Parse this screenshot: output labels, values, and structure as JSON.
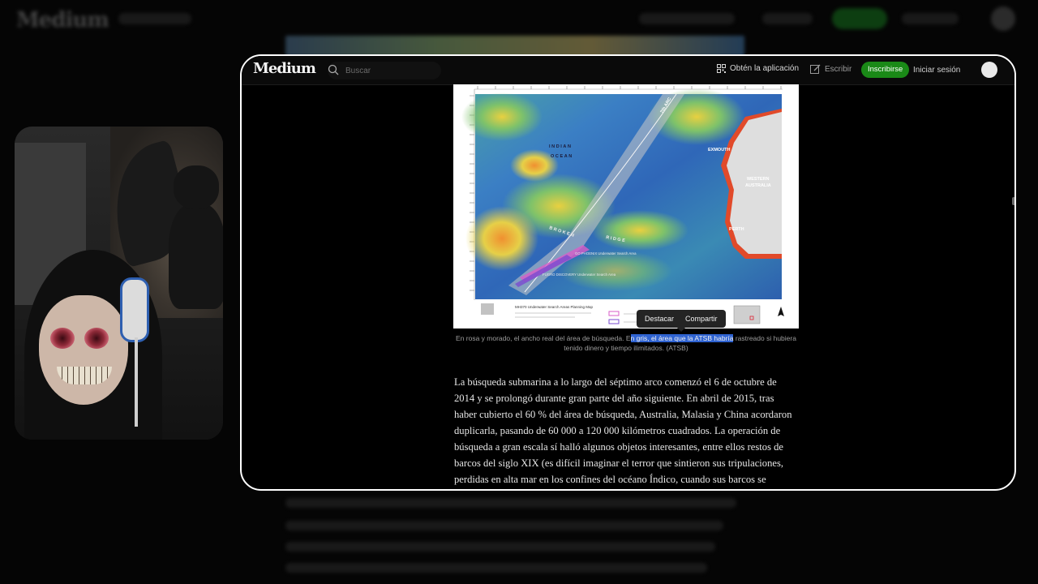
{
  "background_page": {
    "logo": "Medium"
  },
  "header": {
    "logo": "Medium",
    "search_placeholder": "Buscar",
    "get_app": "Obtén la aplicación",
    "write": "Escribir",
    "signup": "Inscribirse",
    "login": "Iniciar sesión"
  },
  "figure": {
    "caption_before": "En rosa y morado, el ancho real del área de búsqueda. E",
    "caption_highlight": "n gris, el área que la ATSB habría",
    "caption_after": " rastreado si hubiera tenido dinero y tiempo ilimitados. (ATSB)",
    "map_labels": {
      "ocean1": "INDIAN",
      "ocean2": "OCEAN",
      "region1": "WESTERN",
      "region2": "AUSTRALIA",
      "city1": "EXMOUTH",
      "city2": "PERTH",
      "ridge1": "BROKEN",
      "ridge2": "RIDGE",
      "arc": "7th ARC",
      "area1": "GO PHOENIX Underwater Search Area",
      "area2": "FUGRO DISCOVERY Underwater Search Area",
      "map_title": "MH370  Underwater Search Areas Planning Map"
    }
  },
  "tooltip": {
    "highlight": "Destacar",
    "share": "Compartir"
  },
  "article": {
    "paragraph": "La búsqueda submarina a lo largo del séptimo arco comenzó el 6 de octubre de 2014 y se prolongó durante gran parte del año siguiente. En abril de 2015, tras haber cubierto el 60 % del área de búsqueda, Australia, Malasia y China acordaron duplicarla, pasando de 60 000 a 120 000 kilómetros cuadrados. La operación de búsqueda a gran escala sí halló algunos objetos interesantes, entre ellos restos de barcos del siglo XIX (es difícil imaginar el terror que sintieron sus tripulaciones, perdidas en alta mar en los confines del océano Índico, cuando sus barcos se hundieron)."
  },
  "colors": {
    "accent_green": "#1a8917",
    "selection_blue": "#2f63d1",
    "page_bg": "#000000"
  }
}
